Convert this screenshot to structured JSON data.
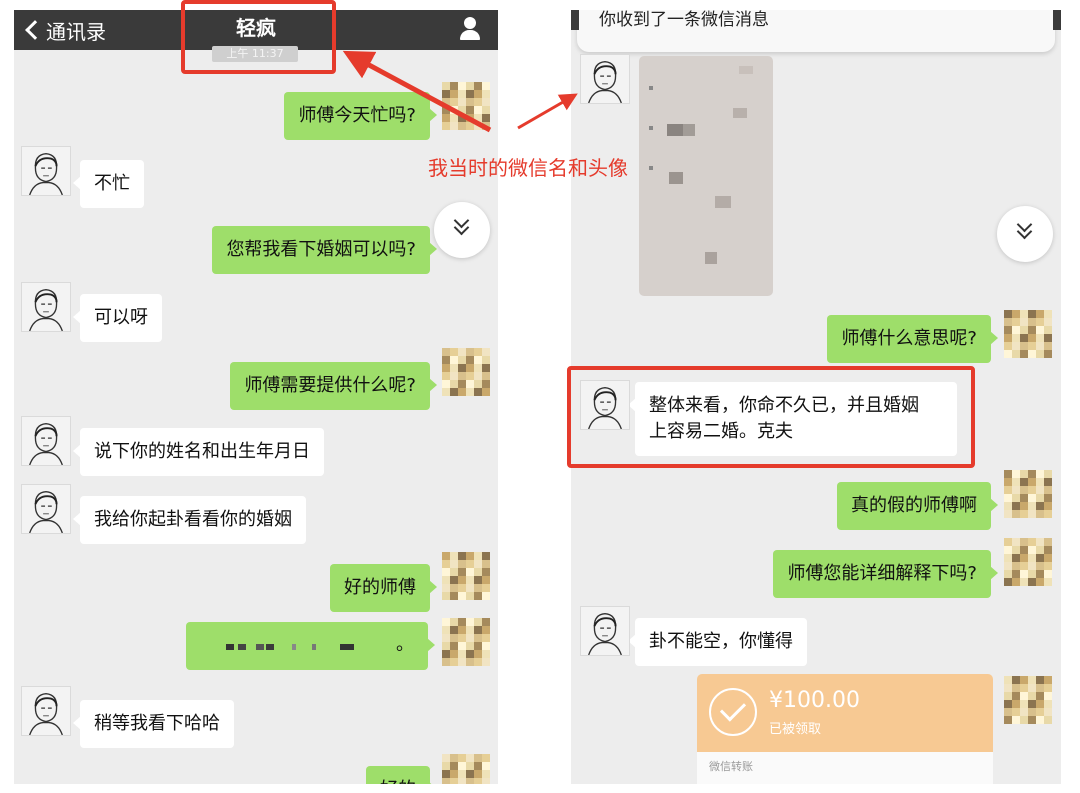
{
  "left_chat": {
    "nav": {
      "back_label": "通讯录",
      "title": "轻疯"
    },
    "time_label": "上午 11:37",
    "messages": [
      {
        "from": "self",
        "text": "师傅今天忙吗?"
      },
      {
        "from": "other",
        "text": "不忙"
      },
      {
        "from": "self",
        "text": "您帮我看下婚姻可以吗?"
      },
      {
        "from": "other",
        "text": "可以呀"
      },
      {
        "from": "self",
        "text": "师傅需要提供什么呢?"
      },
      {
        "from": "other",
        "text": "说下你的姓名和出生年月日"
      },
      {
        "from": "other",
        "text": "我给你起卦看看你的婚姻"
      },
      {
        "from": "self",
        "text": "好的师傅"
      },
      {
        "from": "self",
        "text": "。"
      },
      {
        "from": "other",
        "text": "稍等我看下哈哈"
      },
      {
        "from": "self",
        "text": "好的"
      }
    ]
  },
  "annotation": {
    "text": "我当时的微信名和头像",
    "color": "#e53b2c"
  },
  "right_chat": {
    "notification": "你收到了一条微信消息",
    "messages": [
      {
        "from": "self",
        "text": "师傅什么意思呢?"
      },
      {
        "from": "other",
        "text_line1": "整体来看，你命不久已，并且婚姻",
        "text_line2": "上容易二婚。克夫"
      },
      {
        "from": "self",
        "text": "真的假的师傅啊"
      },
      {
        "from": "self",
        "text": "师傅您能详细解释下吗?"
      },
      {
        "from": "other",
        "text": "卦不能空，你懂得"
      }
    ],
    "transfer": {
      "amount": "¥100.00",
      "status": "已被领取",
      "footer": "微信转账"
    }
  },
  "colors": {
    "bubble_self": "#9ede6a",
    "bubble_other": "#ffffff",
    "chat_bg": "#ededed",
    "nav_bg": "#3a3a3a",
    "highlight": "#e53b2c",
    "transfer": "#f7c993"
  },
  "icons": [
    "back-chevron-icon",
    "person-icon",
    "double-chevron-down-icon",
    "check-circle-icon"
  ]
}
